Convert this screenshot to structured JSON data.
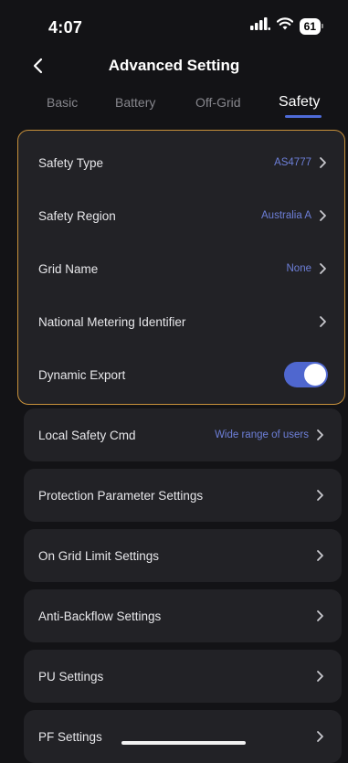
{
  "status_bar": {
    "time": "4:07",
    "battery": "61"
  },
  "header": {
    "title": "Advanced Setting"
  },
  "tabs": [
    {
      "label": "Basic"
    },
    {
      "label": "Battery"
    },
    {
      "label": "Off-Grid"
    },
    {
      "label": "Safety"
    }
  ],
  "active_tab": "Safety",
  "safety_group": [
    {
      "label": "Safety Type",
      "value": "AS4777"
    },
    {
      "label": "Safety Region",
      "value": "Australia A"
    },
    {
      "label": "Grid Name",
      "value": "None"
    },
    {
      "label": "National Metering Identifier",
      "value": ""
    },
    {
      "label": "Dynamic Export",
      "toggle": true
    }
  ],
  "cards": [
    {
      "label": "Local Safety Cmd",
      "value": "Wide range of users"
    },
    {
      "label": "Protection Parameter Settings",
      "value": ""
    },
    {
      "label": "On Grid Limit Settings",
      "value": ""
    },
    {
      "label": "Anti-Backflow Settings",
      "value": ""
    },
    {
      "label": "PU Settings",
      "value": ""
    },
    {
      "label": "PF Settings",
      "value": ""
    }
  ],
  "colors": {
    "accent": "#4f67cf",
    "value_text": "#6d7fd8",
    "highlight_border": "#c8913b",
    "card_bg": "#222226",
    "page_bg": "#131316"
  }
}
